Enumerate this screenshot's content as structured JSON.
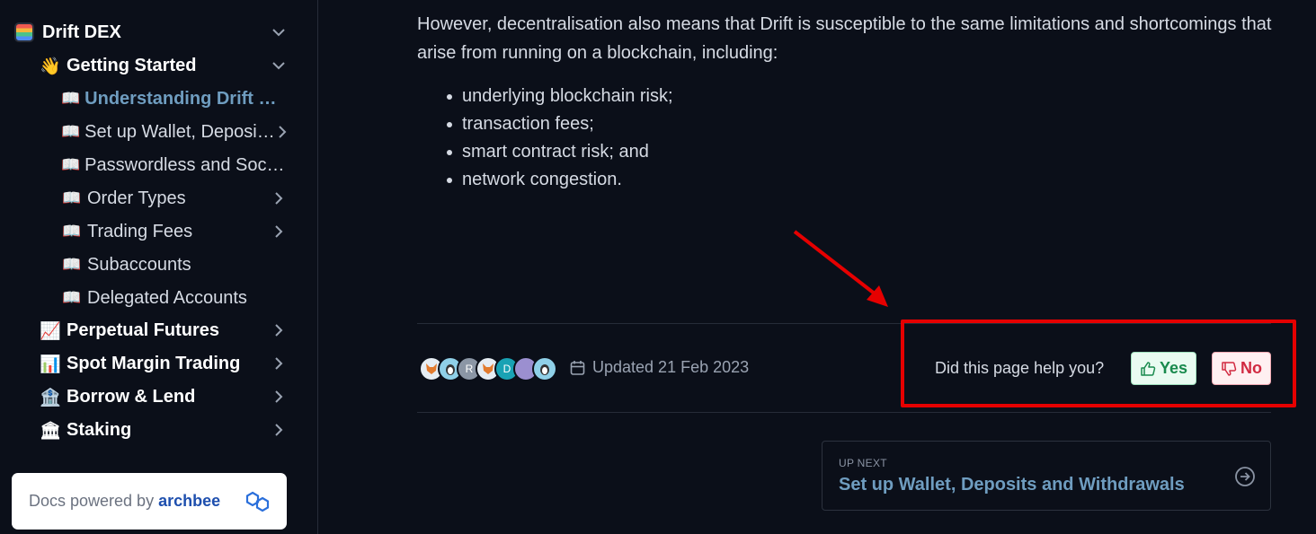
{
  "sidebar": {
    "root": {
      "label": "Drift DEX"
    },
    "section": {
      "emoji": "👋",
      "label": "Getting Started"
    },
    "pages": [
      {
        "emoji": "📖",
        "label": "Understanding Drift Protocol"
      },
      {
        "emoji": "📖",
        "label": "Set up Wallet, Deposits and Withdrawals"
      },
      {
        "emoji": "📖",
        "label": "Passwordless and Social Login"
      },
      {
        "emoji": "📖",
        "label": "Order Types"
      },
      {
        "emoji": "📖",
        "label": "Trading Fees"
      },
      {
        "emoji": "📖",
        "label": "Subaccounts"
      },
      {
        "emoji": "📖",
        "label": "Delegated Accounts"
      }
    ],
    "sections": [
      {
        "emoji": "📈",
        "label": "Perpetual Futures"
      },
      {
        "emoji": "📊",
        "label": "Spot Margin Trading"
      },
      {
        "emoji": "🏦",
        "label": "Borrow & Lend"
      },
      {
        "emoji": "🏛",
        "label": "Staking"
      }
    ],
    "powered": {
      "text": "Docs powered by",
      "brand": "archbee"
    }
  },
  "content": {
    "paragraph": "However, decentralisation also means that Drift is susceptible to the same limitations and shortcomings that arise from running on a blockchain, including:",
    "bullets": [
      "underlying blockchain risk;",
      "transaction fees;",
      "smart contract risk; and",
      "network congestion."
    ]
  },
  "footer": {
    "avatars": [
      {
        "kind": "fox",
        "color": "#e6edf3"
      },
      {
        "kind": "penguin",
        "color": "#8fd0e8"
      },
      {
        "letter": "R",
        "color": "#8b96a5"
      },
      {
        "kind": "fox",
        "color": "#e6edf3"
      },
      {
        "letter": "D",
        "color": "#19a2b4"
      },
      {
        "kind": "blank",
        "color": "#9b8fd0"
      },
      {
        "kind": "penguin",
        "color": "#8fd0e8"
      }
    ],
    "updated": "Updated 21 Feb 2023",
    "question": "Did this page help you?",
    "yes_label": "Yes",
    "no_label": "No"
  },
  "up_next": {
    "caption": "UP NEXT",
    "title": "Set up Wallet, Deposits and Withdrawals"
  },
  "colors": {
    "accent": "#6f9dc0",
    "annotation": "#e60000",
    "yes": "#188a4d",
    "no": "#d12a41"
  }
}
